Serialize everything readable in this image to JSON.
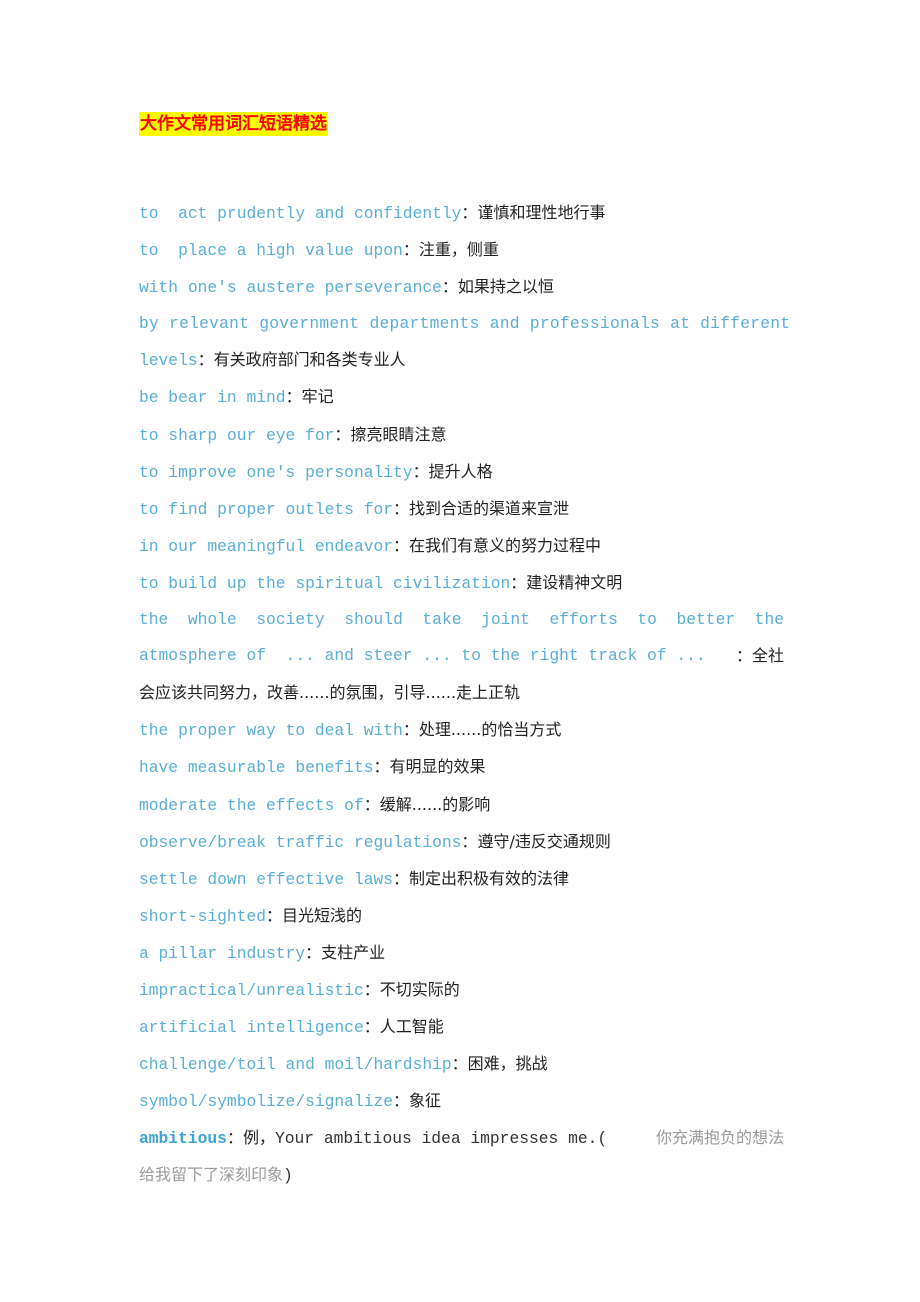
{
  "document": {
    "title": "大作文常用词汇短语精选",
    "colors": {
      "title_text": "#ff0000",
      "title_highlight": "#ffff00",
      "english_phrase": "#5aaed5",
      "chinese_text": "#222222",
      "gray_translation": "#9a9a9a"
    },
    "entries": [
      {
        "en": "to  act prudently and confidently",
        "sep": "：",
        "zh": "谨慎和理性地行事"
      },
      {
        "en": "to  place a high value upon",
        "sep": "：",
        "zh": "注重，侧重"
      },
      {
        "en": "with one's austere perseverance",
        "sep": "：",
        "zh": "如果持之以恒"
      },
      {
        "en_line1": "by relevant government departments and professionals at different",
        "en_line2": "levels",
        "sep": "：",
        "zh": "有关政府部门和各类专业人"
      },
      {
        "en": "be bear in mind",
        "sep": "：",
        "zh": "牢记"
      },
      {
        "en": "to sharp our eye for",
        "sep": "：",
        "zh": "擦亮眼睛注意"
      },
      {
        "en": "to improve one's personality",
        "sep": "：",
        "zh": "提升人格"
      },
      {
        "en": "to find proper outlets for",
        "sep": "：",
        "zh": "找到合适的渠道来宣泄"
      },
      {
        "en": "in our meaningful endeavor",
        "sep": "：",
        "zh": "在我们有意义的努力过程中"
      },
      {
        "en": "to build up the spiritual civilization",
        "sep": "：",
        "zh": "建设精神文明"
      },
      {
        "en_line1": "the whole society should take joint efforts to better the",
        "en_line2": "atmosphere of  ... and steer ... to the right track of ...",
        "sep": "：",
        "zh_line2": "全社",
        "zh_line3": "会应该共同努力，改善......的氛围，引导......走上正轨"
      },
      {
        "en": "the proper way to deal with",
        "sep": "：",
        "zh": "处理......的恰当方式"
      },
      {
        "en": "have measurable benefits",
        "sep": "：",
        "zh": "有明显的效果"
      },
      {
        "en": "moderate the effects of",
        "sep": "：",
        "zh": "缓解......的影响"
      },
      {
        "en": "observe/break traffic regulations",
        "sep": "：",
        "zh": "遵守/违反交通规则"
      },
      {
        "en": "settle down effective laws",
        "sep": "：",
        "zh": "制定出积极有效的法律"
      },
      {
        "en": "short-sighted",
        "sep": "：",
        "zh": "目光短浅的"
      },
      {
        "en": "a pillar industry",
        "sep": "：",
        "zh": "支柱产业"
      },
      {
        "en": "impractical/unrealistic",
        "sep": "：",
        "zh": "不切实际的"
      },
      {
        "en": "artificial intelligence",
        "sep": "：",
        "zh": "人工智能"
      },
      {
        "en": "challenge/toil and moil/hardship",
        "sep": "：",
        "zh": "困难，挑战"
      },
      {
        "en": "symbol/symbolize/signalize",
        "sep": "：",
        "zh": "象征"
      },
      {
        "en": "ambitious",
        "sep": "：",
        "zh_prefix": "例，",
        "example": "Your ambitious idea impresses me.(",
        "zh_gray_line1": "你充满抱负的想法",
        "zh_gray_line2": "给我留下了深刻印象",
        "close": ")"
      }
    ]
  }
}
